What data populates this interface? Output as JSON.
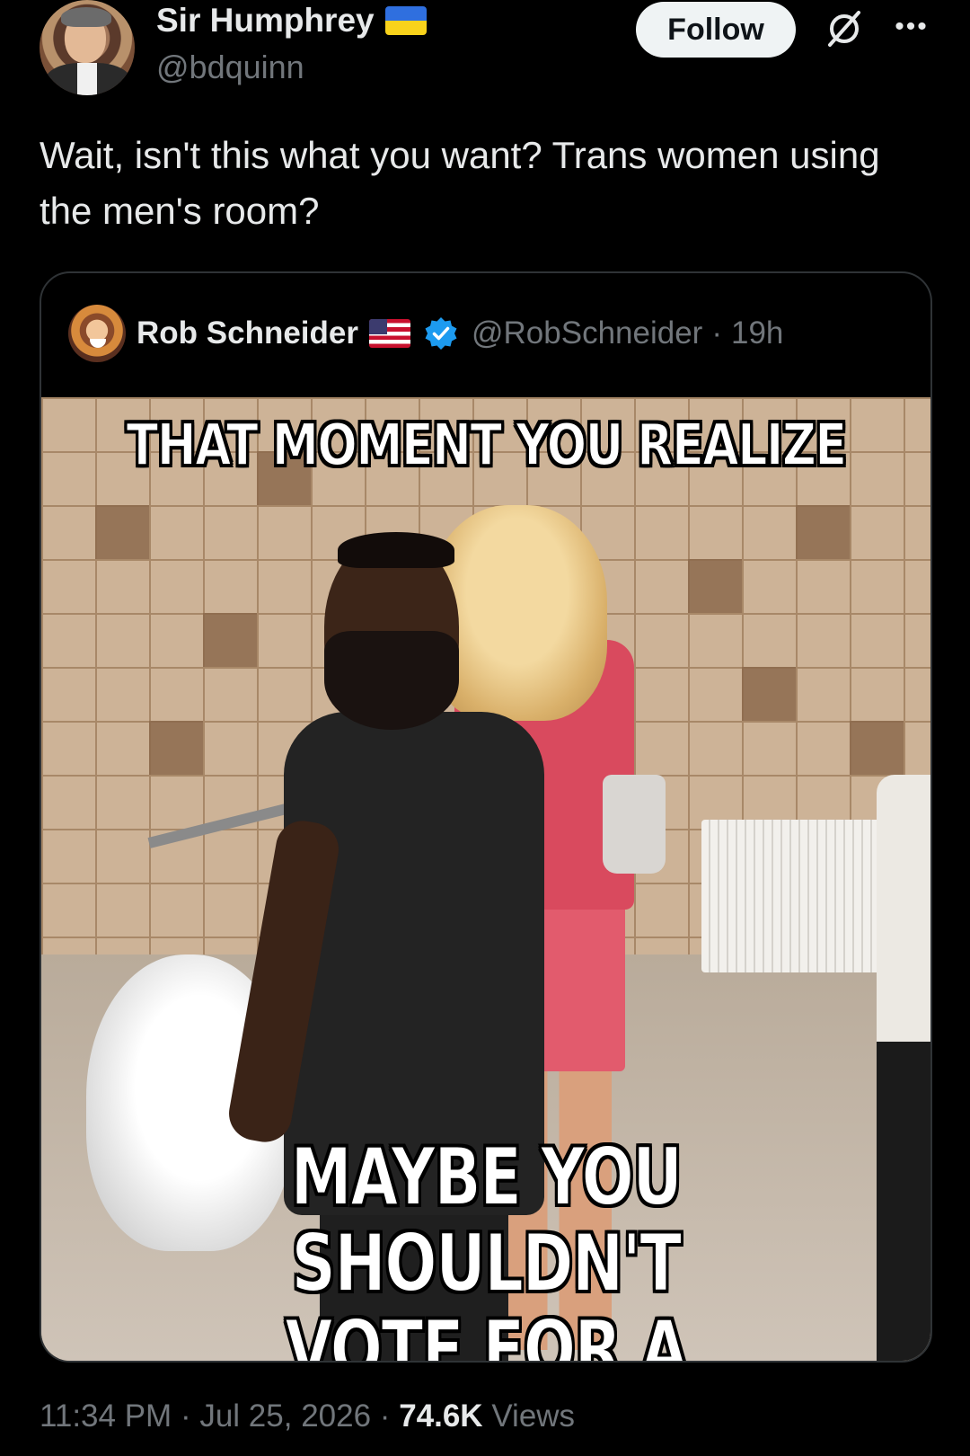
{
  "author": {
    "display_name": "Sir Humphrey",
    "handle": "@bdquinn",
    "flag_icon": "ukraine-flag-icon"
  },
  "follow_label": "Follow",
  "more_label": "•••",
  "tweet": {
    "text": "Wait, isn't this what you want? Trans women using the men's room?"
  },
  "quoted": {
    "display_name": "Rob Schneider",
    "flag_icon": "usa-flag-icon",
    "verified_icon": "verified-badge-icon",
    "handle": "@RobSchneider",
    "separator": "·",
    "time": "19h",
    "meme": {
      "top_text": "THAT MOMENT YOU REALIZE",
      "bottom_line1": "MAYBE YOU SHOULDN'T",
      "bottom_line2": "VOTE FOR A DEMOCRAT"
    }
  },
  "footer": {
    "time": "11:34 PM",
    "separator": "·",
    "date": "Jul 25, 2026",
    "views_count": "74.6K",
    "views_label": "Views"
  },
  "colors": {
    "background": "#000000",
    "text_primary": "#e7e9ea",
    "text_secondary": "#71767b",
    "follow_bg": "#eff3f4",
    "verified_blue": "#1d9bf0",
    "border": "#2f3336"
  }
}
